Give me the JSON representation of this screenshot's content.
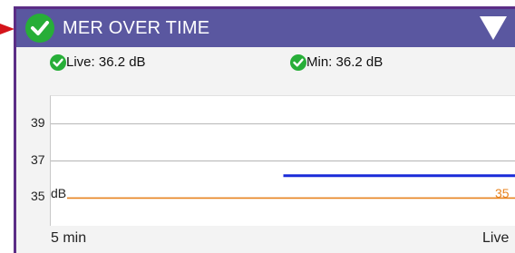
{
  "header": {
    "title": "MER OVER TIME",
    "status_icon": "check-circle-icon",
    "collapse_icon": "triangle-down-icon",
    "colors": {
      "bar": "#5a57a0",
      "ok": "#27ae38",
      "frame": "#5b2d86"
    }
  },
  "stats": {
    "live_label": "Live: 36.2 dB",
    "min_label": "Min: 36.2 dB"
  },
  "chart_data": {
    "type": "line",
    "y_ticks": [
      "39",
      "37",
      "35"
    ],
    "ylim": [
      33.5,
      40.5
    ],
    "yunit": "dB",
    "x_start_label": "5 min",
    "x_end_label": "Live",
    "series": [
      {
        "color": "#1a2bd9",
        "x": [
          0.5,
          1.0
        ],
        "values": [
          36.2,
          36.2
        ]
      },
      {
        "color": "#e8831f",
        "x": [
          0.0,
          1.0
        ],
        "values": [
          35,
          35
        ]
      }
    ],
    "threshold_value_label": "35",
    "grid": "horizontal"
  }
}
